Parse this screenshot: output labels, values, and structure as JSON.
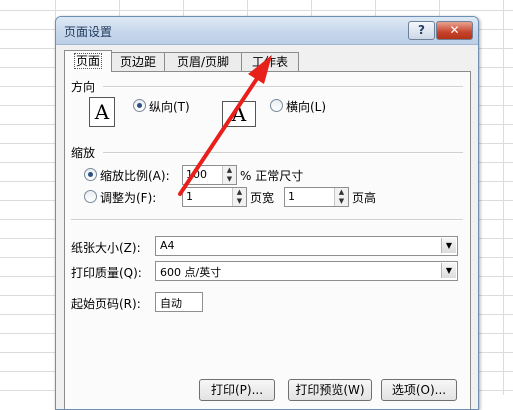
{
  "dialog": {
    "title": "页面设置",
    "help_label": "?",
    "close_label": "✕"
  },
  "tabs": [
    {
      "label": "页面",
      "active": true
    },
    {
      "label": "页边距",
      "active": false
    },
    {
      "label": "页眉/页脚",
      "active": false
    },
    {
      "label": "工作表",
      "active": false
    }
  ],
  "orientation": {
    "heading": "方向",
    "portrait_label": "纵向(T)",
    "landscape_label": "横向(L)",
    "portrait_icon": "A",
    "landscape_icon": "A",
    "selected": "portrait"
  },
  "scaling": {
    "heading": "缩放",
    "adjust_label": "缩放比例(A):",
    "adjust_value": "100",
    "adjust_suffix": "% 正常尺寸",
    "fit_label": "调整为(F):",
    "fit_wide_value": "1",
    "fit_wide_label": "页宽",
    "fit_tall_value": "1",
    "fit_tall_label": "页高",
    "selected": "adjust"
  },
  "paper": {
    "size_label": "纸张大小(Z):",
    "size_value": "A4",
    "quality_label": "打印质量(Q):",
    "quality_value": "600 点/英寸",
    "first_page_label": "起始页码(R):",
    "first_page_value": "自动"
  },
  "buttons": {
    "print": "打印(P)...",
    "preview": "打印预览(W)",
    "options": "选项(O)..."
  },
  "icons": {
    "spin_up": "▲",
    "spin_down": "▼",
    "dropdown": "▼"
  },
  "colors": {
    "annotation": "#e8201c",
    "title_bar": "#c7d7ec",
    "close_button": "#c6432b"
  }
}
